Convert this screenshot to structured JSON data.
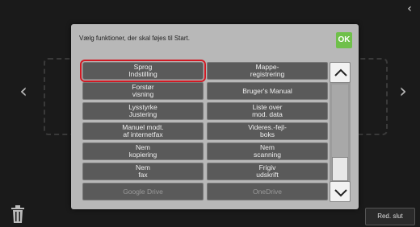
{
  "dialog": {
    "instruction": "Vælg funktioner, der skal føjes til Start.",
    "ok_label": "OK"
  },
  "functions": [
    {
      "label": "Sprog\nIndstilling",
      "selected": true,
      "enabled": true
    },
    {
      "label": "Mappe-\nregistrering",
      "selected": false,
      "enabled": true
    },
    {
      "label": "Forstør\nvisning",
      "selected": false,
      "enabled": true
    },
    {
      "label": "Bruger's Manual",
      "selected": false,
      "enabled": true
    },
    {
      "label": "Lysstyrke\nJustering",
      "selected": false,
      "enabled": true
    },
    {
      "label": "Liste over\nmod. data",
      "selected": false,
      "enabled": true
    },
    {
      "label": "Manuel modt.\naf internetfax",
      "selected": false,
      "enabled": true
    },
    {
      "label": "Videres.-fejl-\nboks",
      "selected": false,
      "enabled": true
    },
    {
      "label": "Nem\nkopiering",
      "selected": false,
      "enabled": true
    },
    {
      "label": "Nem\nscanning",
      "selected": false,
      "enabled": true
    },
    {
      "label": "Nem\nfax",
      "selected": false,
      "enabled": true
    },
    {
      "label": "Frigiv\nudskrift",
      "selected": false,
      "enabled": true
    },
    {
      "label": "Google Drive",
      "selected": false,
      "enabled": false
    },
    {
      "label": "OneDrive",
      "selected": false,
      "enabled": false
    }
  ],
  "footer": {
    "end_button_label": "Red. slut"
  },
  "colors": {
    "ok_green": "#6fc04a",
    "selection_red": "#d01a24",
    "button_gray": "#5a5a5a"
  }
}
